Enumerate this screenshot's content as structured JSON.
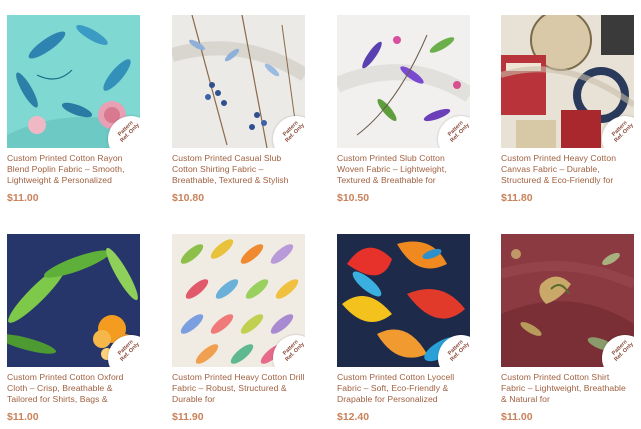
{
  "products": [
    {
      "title": "Custom Printed Cotton Rayon Blend Poplin Fabric – Smooth, Lightweight & Personalized",
      "price": "$11.00",
      "badge": "Pattern Ref. Only"
    },
    {
      "title": "Custom Printed Casual Slub Cotton Shirting Fabric – Breathable, Textured & Stylish",
      "price": "$10.80",
      "badge": "Pattern Ref. Only"
    },
    {
      "title": "Custom Printed Slub Cotton Woven Fabric – Lightweight, Textured & Breathable for",
      "price": "$10.50",
      "badge": "Pattern Ref. Only"
    },
    {
      "title": "Custom Printed Heavy Cotton Canvas Fabric – Durable, Structured & Eco-Friendly for",
      "price": "$11.80",
      "badge": "Pattern Ref. Only"
    },
    {
      "title": "Custom Printed Cotton Oxford Cloth – Crisp, Breathable & Tailored for Shirts, Bags &",
      "price": "$11.00",
      "badge": "Pattern Ref. Only"
    },
    {
      "title": "Custom Printed Heavy Cotton Drill Fabric – Robust, Structured & Durable for",
      "price": "$11.90",
      "badge": "Pattern Ref. Only"
    },
    {
      "title": "Custom Printed Cotton Lyocell Fabric – Soft, Eco-Friendly & Drapable for Personalized",
      "price": "$12.40",
      "badge": "Pattern Ref. Only"
    },
    {
      "title": "Custom Printed Cotton Shirt Fabric – Lightweight, Breathable & Natural for",
      "price": "$11.00",
      "badge": "Pattern Ref. Only"
    }
  ]
}
